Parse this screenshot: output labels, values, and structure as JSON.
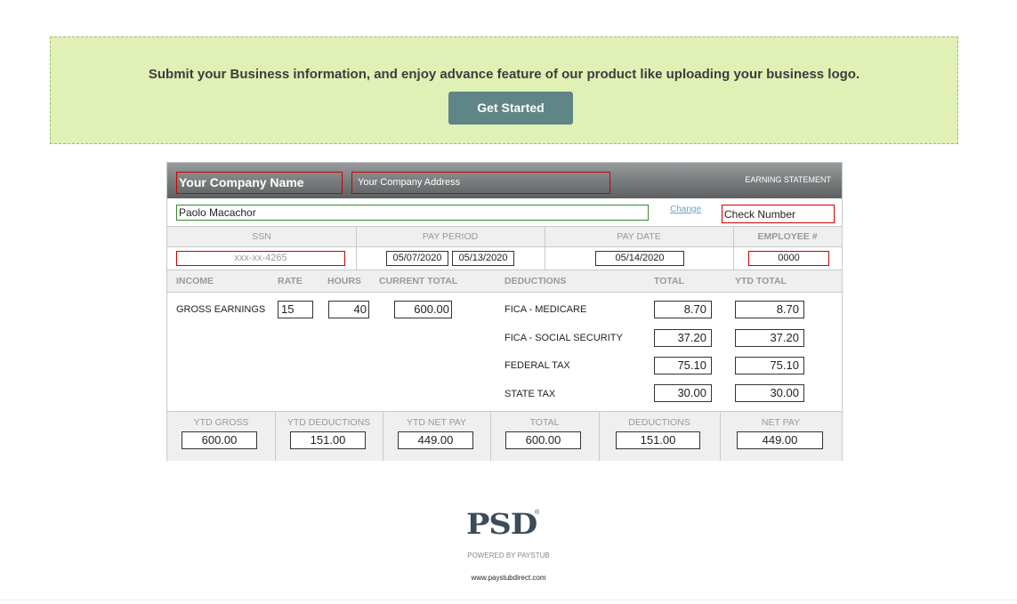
{
  "banner": {
    "message": "Submit your Business information, and enjoy advance feature of our product like uploading your business logo.",
    "button_label": "Get Started"
  },
  "stub": {
    "company_name": "Your Company Name",
    "company_address": "Your Company Address",
    "statement_label": "EARNING STATEMENT",
    "employee_name": "Paolo Macachor",
    "change_link": "Change",
    "check_number": "Check Number",
    "info_headers": {
      "ssn": "SSN",
      "pay_period": "PAY PERIOD",
      "pay_date": "PAY DATE",
      "employee_no": "EMPLOYEE #"
    },
    "ssn": "xxx-xx-4265",
    "pay_period_start": "05/07/2020",
    "pay_period_end": "05/13/2020",
    "pay_date": "05/14/2020",
    "employee_no": "0000",
    "section_headers": {
      "income": "INCOME",
      "rate": "RATE",
      "hours": "HOURS",
      "current_total": "CURRENT TOTAL",
      "deductions": "DEDUCTIONS",
      "total": "TOTAL",
      "ytd_total": "YTD TOTAL"
    },
    "earnings": {
      "label": "GROSS EARNINGS",
      "rate": "15",
      "hours": "40",
      "current_total": "600.00"
    },
    "deductions": [
      {
        "label": "FICA - MEDICARE",
        "total": "8.70",
        "ytd": "8.70"
      },
      {
        "label": "FICA - SOCIAL SECURITY",
        "total": "37.20",
        "ytd": "37.20"
      },
      {
        "label": "FEDERAL TAX",
        "total": "75.10",
        "ytd": "75.10"
      },
      {
        "label": "STATE TAX",
        "total": "30.00",
        "ytd": "30.00"
      }
    ],
    "summary": [
      {
        "label": "YTD GROSS",
        "value": "600.00"
      },
      {
        "label": "YTD DEDUCTIONS",
        "value": "151.00"
      },
      {
        "label": "YTD NET PAY",
        "value": "449.00"
      },
      {
        "label": "TOTAL",
        "value": "600.00"
      },
      {
        "label": "DEDUCTIONS",
        "value": "151.00"
      },
      {
        "label": "NET PAY",
        "value": "449.00"
      }
    ]
  },
  "footer": {
    "logo_text": "PSD",
    "registered": "®",
    "powered_by": "POWERED BY PAYSTUB",
    "url": "www.paystubdirect.com"
  }
}
